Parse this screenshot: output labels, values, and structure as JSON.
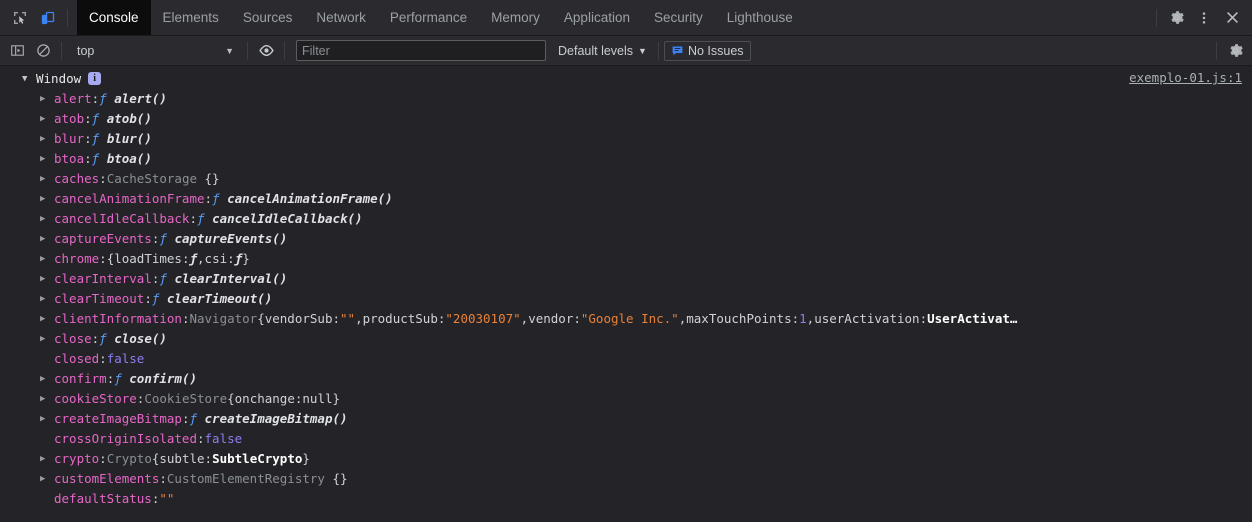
{
  "tabbar": {
    "tabs": [
      {
        "label": "Console",
        "active": true
      },
      {
        "label": "Elements",
        "active": false
      },
      {
        "label": "Sources",
        "active": false
      },
      {
        "label": "Network",
        "active": false
      },
      {
        "label": "Performance",
        "active": false
      },
      {
        "label": "Memory",
        "active": false
      },
      {
        "label": "Application",
        "active": false
      },
      {
        "label": "Security",
        "active": false
      },
      {
        "label": "Lighthouse",
        "active": false
      }
    ],
    "icons": {
      "inspect": "inspect-element-icon",
      "device": "device-toolbar-icon",
      "settings": "gear-icon",
      "more": "more-options-icon",
      "close": "close-icon"
    },
    "accent_color": "#3b82f6"
  },
  "filterbar": {
    "context": "top",
    "filter_placeholder": "Filter",
    "filter_value": "",
    "levels_label": "Default levels",
    "issues_label": "No Issues",
    "caret": "▼",
    "icons": {
      "sidebar": "console-sidebar-icon",
      "clear": "clear-console-icon",
      "eye": "live-expression-icon",
      "issues": "issues-bubble-icon",
      "settings": "gear-icon"
    }
  },
  "console": {
    "source_link": "exemplo-01.js:1",
    "root": {
      "label": "Window",
      "badge": "i",
      "expanded": true
    },
    "properties": [
      {
        "arrow": true,
        "name": "alert",
        "sep": ": ",
        "kind": "function",
        "fkw": "ƒ",
        "fname": "alert()"
      },
      {
        "arrow": true,
        "name": "atob",
        "sep": ": ",
        "kind": "function",
        "fkw": "ƒ",
        "fname": "atob()"
      },
      {
        "arrow": true,
        "name": "blur",
        "sep": ": ",
        "kind": "function",
        "fkw": "ƒ",
        "fname": "blur()"
      },
      {
        "arrow": true,
        "name": "btoa",
        "sep": ": ",
        "kind": "function",
        "fkw": "ƒ",
        "fname": "btoa()"
      },
      {
        "arrow": true,
        "name": "caches",
        "sep": ": ",
        "kind": "object",
        "cls": "CacheStorage",
        "preview": "{}"
      },
      {
        "arrow": true,
        "name": "cancelAnimationFrame",
        "sep": ": ",
        "kind": "function",
        "fkw": "ƒ",
        "fname": "cancelAnimationFrame()"
      },
      {
        "arrow": true,
        "name": "cancelIdleCallback",
        "sep": ": ",
        "kind": "function",
        "fkw": "ƒ",
        "fname": "cancelIdleCallback()"
      },
      {
        "arrow": true,
        "name": "captureEvents",
        "sep": ": ",
        "kind": "function",
        "fkw": "ƒ",
        "fname": "captureEvents()"
      },
      {
        "arrow": true,
        "name": "chrome",
        "sep": ": ",
        "kind": "chrome-preview"
      },
      {
        "arrow": true,
        "name": "clearInterval",
        "sep": ": ",
        "kind": "function",
        "fkw": "ƒ",
        "fname": "clearInterval()"
      },
      {
        "arrow": true,
        "name": "clearTimeout",
        "sep": ": ",
        "kind": "function",
        "fkw": "ƒ",
        "fname": "clearTimeout()"
      },
      {
        "arrow": true,
        "name": "clientInformation",
        "sep": ": ",
        "kind": "navigator-preview"
      },
      {
        "arrow": true,
        "name": "close",
        "sep": ": ",
        "kind": "function",
        "fkw": "ƒ",
        "fname": "close()"
      },
      {
        "arrow": false,
        "name": "closed",
        "sep": ": ",
        "kind": "bool",
        "value": "false"
      },
      {
        "arrow": true,
        "name": "confirm",
        "sep": ": ",
        "kind": "function",
        "fkw": "ƒ",
        "fname": "confirm()"
      },
      {
        "arrow": true,
        "name": "cookieStore",
        "sep": ": ",
        "kind": "cookiestore-preview"
      },
      {
        "arrow": true,
        "name": "createImageBitmap",
        "sep": ": ",
        "kind": "function",
        "fkw": "ƒ",
        "fname": "createImageBitmap()"
      },
      {
        "arrow": false,
        "name": "crossOriginIsolated",
        "sep": ": ",
        "kind": "bool",
        "value": "false"
      },
      {
        "arrow": true,
        "name": "crypto",
        "sep": ": ",
        "kind": "crypto-preview"
      },
      {
        "arrow": true,
        "name": "customElements",
        "sep": ": ",
        "kind": "object",
        "cls": "CustomElementRegistry",
        "preview": "{}"
      },
      {
        "arrow": false,
        "name": "defaultStatus",
        "sep": ": ",
        "kind": "string",
        "value": "\"\""
      }
    ],
    "previews": {
      "chrome": {
        "open": "{",
        "k1": "loadTimes",
        "c1": ": ",
        "f1": "ƒ",
        "comma1": ", ",
        "k2": "csi",
        "c2": ": ",
        "f2": "ƒ",
        "close": "}"
      },
      "navigator": {
        "cls": "Navigator",
        "open": " {",
        "k1": "vendorSub",
        "c1": ": ",
        "v1": "\"\"",
        "sep1": ", ",
        "k2": "productSub",
        "c2": ": ",
        "v2": "\"20030107\"",
        "sep2": ", ",
        "k3": "vendor",
        "c3": ": ",
        "v3": "\"Google Inc.\"",
        "sep3": ", ",
        "k4": "maxTouchPoints",
        "c4": ": ",
        "v4": "1",
        "sep4": ", ",
        "k5": "userActivation",
        "c5": ": ",
        "v5": "UserActivat…"
      },
      "cookiestore": {
        "cls": "CookieStore",
        "open": " {",
        "k1": "onchange",
        "c1": ": ",
        "v1": "null",
        "close": "}"
      },
      "crypto": {
        "cls": "Crypto",
        "open": " {",
        "k1": "subtle",
        "c1": ": ",
        "v1": "SubtleCrypto",
        "close": "}"
      }
    }
  },
  "colors": {
    "background": "#242428",
    "toolbar": "#2b2b2f",
    "active_tab": "#0c0c0d",
    "property": "#e666c8",
    "string": "#e8813a",
    "number": "#8c7ef0",
    "keyword": "#5a9cf8",
    "badge": "#a6aaf0"
  }
}
